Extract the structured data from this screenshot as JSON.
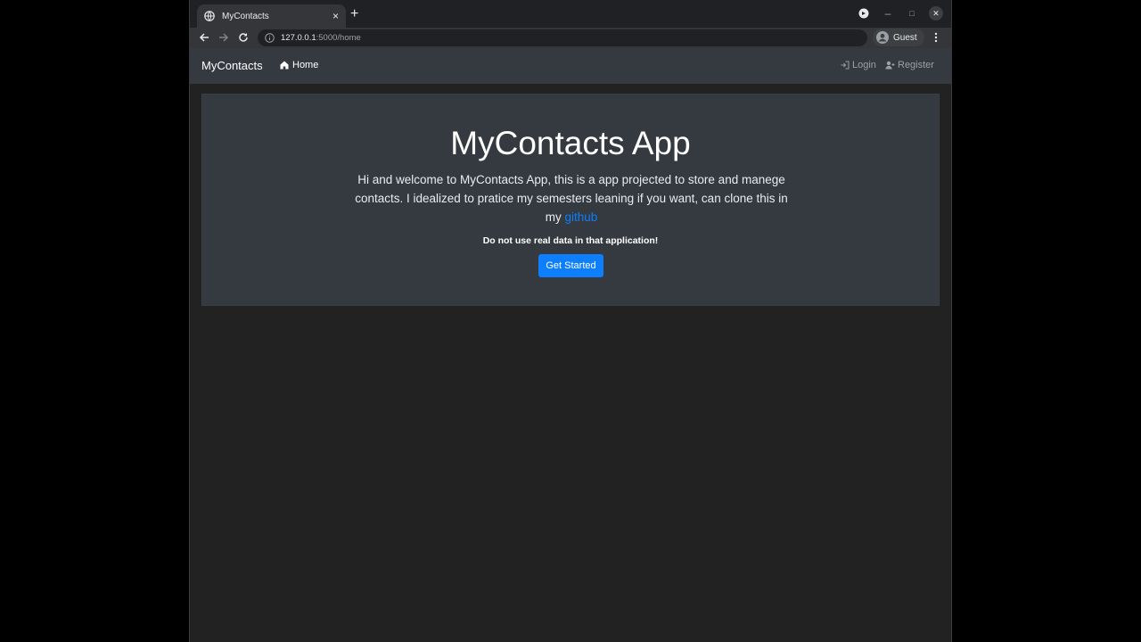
{
  "browser": {
    "tab": {
      "title": "MyContacts",
      "close_glyph": "×",
      "favicon_icon": "globe-icon"
    },
    "new_tab_glyph": "+",
    "window_controls": {
      "minimize": "–",
      "maximize": "□",
      "close": "✕"
    },
    "address": {
      "host": "127.0.0.1",
      "path": ":5000/home"
    },
    "profile_label": "Guest"
  },
  "navbar": {
    "brand": "MyContacts",
    "home_label": "Home",
    "login_label": "Login",
    "register_label": "Register"
  },
  "hero": {
    "title": "MyContacts App",
    "lead": "Hi and welcome to MyContacts App, this is a app projected to store and manege contacts. I idealized to pratice my semesters leaning if you want, can clone this in my ",
    "link_label": "github",
    "warning": "Do not use real data in that application!",
    "button_label": "Get Started"
  },
  "colors": {
    "page_bg": "#222222",
    "navbar_bg": "#343a40",
    "primary": "#0d7efc"
  }
}
